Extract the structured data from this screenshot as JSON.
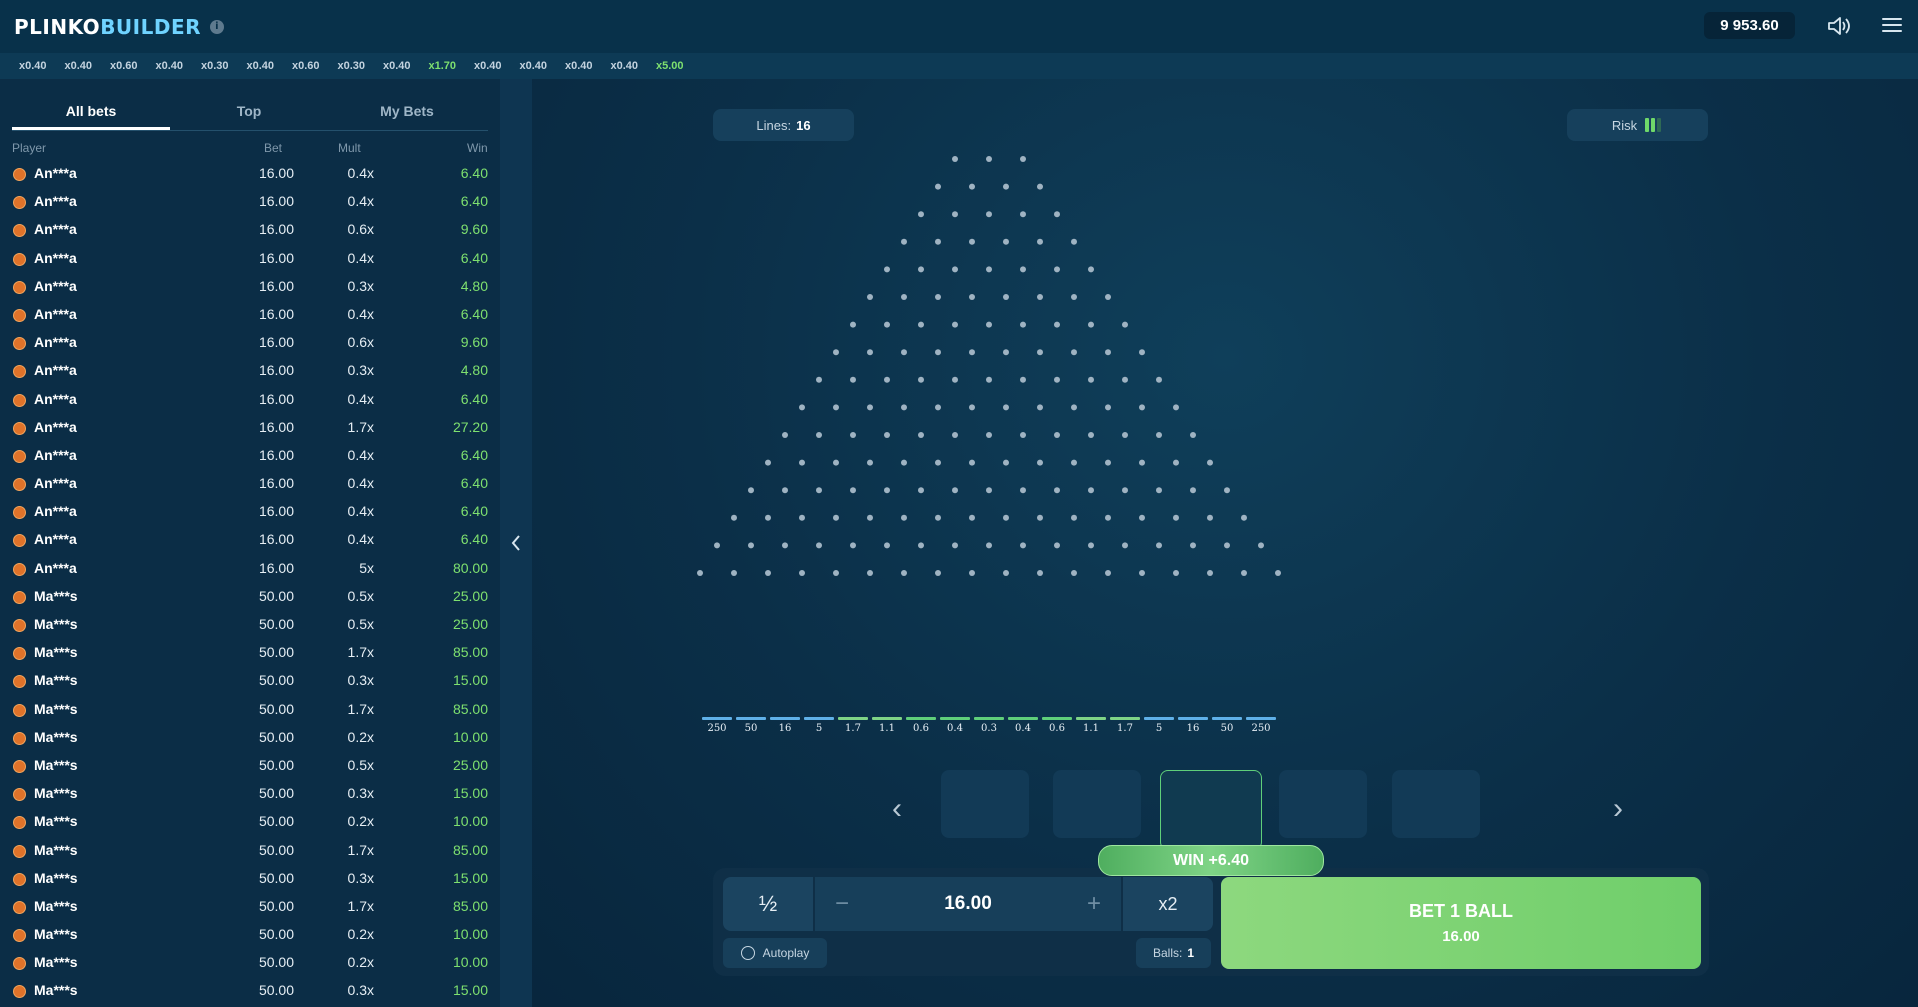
{
  "header": {
    "logo_part1": "PLINKO",
    "logo_part2": "BUILDER",
    "info_icon": "info-icon",
    "balance": "9 953.60"
  },
  "history": [
    "x0.40",
    "x0.40",
    "x0.60",
    "x0.40",
    "x0.30",
    "x0.40",
    "x0.60",
    "x0.30",
    "x0.40",
    "x1.70",
    "x0.40",
    "x0.40",
    "x0.40",
    "x0.40",
    "x5.00"
  ],
  "bets_panel": {
    "tabs": [
      {
        "label": "All bets",
        "active": true
      },
      {
        "label": "Top",
        "active": false
      },
      {
        "label": "My Bets",
        "active": false
      }
    ],
    "columns": {
      "player": "Player",
      "bet": "Bet",
      "mult": "Mult",
      "win": "Win"
    },
    "rows": [
      {
        "player": "An***a",
        "bet": "16.00",
        "mult": "0.4x",
        "win": "6.40"
      },
      {
        "player": "An***a",
        "bet": "16.00",
        "mult": "0.4x",
        "win": "6.40"
      },
      {
        "player": "An***a",
        "bet": "16.00",
        "mult": "0.6x",
        "win": "9.60"
      },
      {
        "player": "An***a",
        "bet": "16.00",
        "mult": "0.4x",
        "win": "6.40"
      },
      {
        "player": "An***a",
        "bet": "16.00",
        "mult": "0.3x",
        "win": "4.80"
      },
      {
        "player": "An***a",
        "bet": "16.00",
        "mult": "0.4x",
        "win": "6.40"
      },
      {
        "player": "An***a",
        "bet": "16.00",
        "mult": "0.6x",
        "win": "9.60"
      },
      {
        "player": "An***a",
        "bet": "16.00",
        "mult": "0.3x",
        "win": "4.80"
      },
      {
        "player": "An***a",
        "bet": "16.00",
        "mult": "0.4x",
        "win": "6.40"
      },
      {
        "player": "An***a",
        "bet": "16.00",
        "mult": "1.7x",
        "win": "27.20"
      },
      {
        "player": "An***a",
        "bet": "16.00",
        "mult": "0.4x",
        "win": "6.40"
      },
      {
        "player": "An***a",
        "bet": "16.00",
        "mult": "0.4x",
        "win": "6.40"
      },
      {
        "player": "An***a",
        "bet": "16.00",
        "mult": "0.4x",
        "win": "6.40"
      },
      {
        "player": "An***a",
        "bet": "16.00",
        "mult": "0.4x",
        "win": "6.40"
      },
      {
        "player": "An***a",
        "bet": "16.00",
        "mult": "5x",
        "win": "80.00"
      },
      {
        "player": "Ma***s",
        "bet": "50.00",
        "mult": "0.5x",
        "win": "25.00"
      },
      {
        "player": "Ma***s",
        "bet": "50.00",
        "mult": "0.5x",
        "win": "25.00"
      },
      {
        "player": "Ma***s",
        "bet": "50.00",
        "mult": "1.7x",
        "win": "85.00"
      },
      {
        "player": "Ma***s",
        "bet": "50.00",
        "mult": "0.3x",
        "win": "15.00"
      },
      {
        "player": "Ma***s",
        "bet": "50.00",
        "mult": "1.7x",
        "win": "85.00"
      },
      {
        "player": "Ma***s",
        "bet": "50.00",
        "mult": "0.2x",
        "win": "10.00"
      },
      {
        "player": "Ma***s",
        "bet": "50.00",
        "mult": "0.5x",
        "win": "25.00"
      },
      {
        "player": "Ma***s",
        "bet": "50.00",
        "mult": "0.3x",
        "win": "15.00"
      },
      {
        "player": "Ma***s",
        "bet": "50.00",
        "mult": "0.2x",
        "win": "10.00"
      },
      {
        "player": "Ma***s",
        "bet": "50.00",
        "mult": "1.7x",
        "win": "85.00"
      },
      {
        "player": "Ma***s",
        "bet": "50.00",
        "mult": "0.3x",
        "win": "15.00"
      },
      {
        "player": "Ma***s",
        "bet": "50.00",
        "mult": "1.7x",
        "win": "85.00"
      },
      {
        "player": "Ma***s",
        "bet": "50.00",
        "mult": "0.2x",
        "win": "10.00"
      },
      {
        "player": "Ma***s",
        "bet": "50.00",
        "mult": "0.2x",
        "win": "10.00"
      },
      {
        "player": "Ma***s",
        "bet": "50.00",
        "mult": "0.3x",
        "win": "15.00"
      }
    ]
  },
  "game": {
    "lines_label": "Lines:",
    "lines_value": "16",
    "risk_label": "Risk",
    "risk_level": 2,
    "risk_max": 3,
    "multipliers": [
      "250",
      "50",
      "16",
      "5",
      "1.7",
      "1.1",
      "0.6",
      "0.4",
      "0.3",
      "0.4",
      "0.6",
      "1.1",
      "1.7",
      "5",
      "16",
      "50",
      "250"
    ],
    "win_text": "WIN +6.40",
    "half_label": "½",
    "bet_amount": "16.00",
    "double_label": "x2",
    "autoplay_label": "Autoplay",
    "balls_label": "Balls:",
    "balls_value": "1",
    "bet_button_title": "BET 1 BALL",
    "bet_button_amount": "16.00"
  }
}
